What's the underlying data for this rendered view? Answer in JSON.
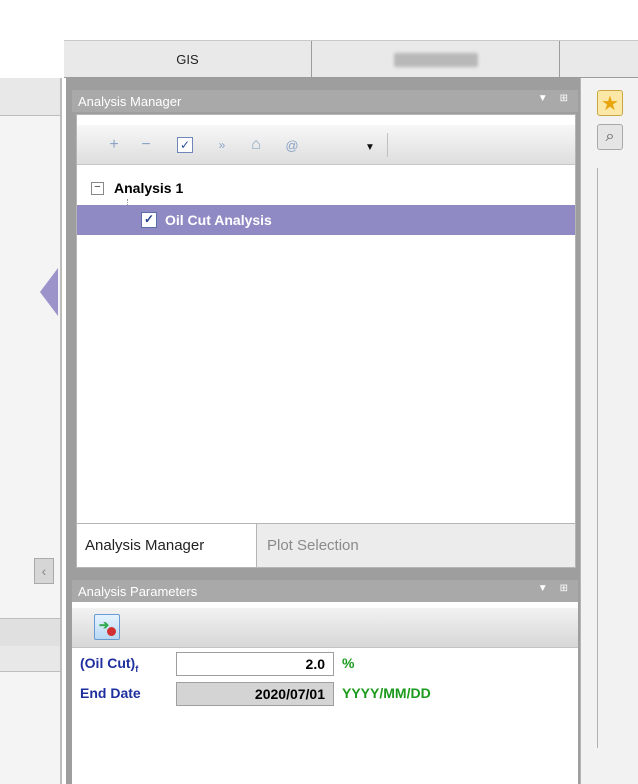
{
  "top_tabs": [
    {
      "label": "GIS"
    },
    {
      "label": ""
    }
  ],
  "analysis_manager": {
    "title": "Analysis Manager",
    "toolbar": {
      "items": [
        "plus-icon",
        "minus-icon",
        "checkbox-icon",
        "chevron-double-down-icon",
        "home-icon",
        "at-icon",
        "dropdown-arrow-icon"
      ]
    },
    "tree": {
      "root_label": "Analysis 1",
      "root_expander": "−",
      "child_label": "Oil Cut Analysis",
      "child_checked": "✓"
    }
  },
  "bottom_tabs": [
    {
      "label": "Analysis Manager"
    },
    {
      "label": "Plot Selection"
    }
  ],
  "analysis_parameters": {
    "title": "Analysis Parameters",
    "rows": [
      {
        "label_main": "(Oil Cut)",
        "label_sub": "f",
        "value": "2.0",
        "unit": "%"
      },
      {
        "label_main": "End Date",
        "label_sub": "",
        "value": "2020/07/01",
        "unit": "YYYY/MM/DD"
      }
    ]
  },
  "colors": {
    "selection": "#8f89c4",
    "titlebar": "#a9a9a9",
    "label_blue": "#1f2f9f",
    "unit_green": "#1c9a1c"
  }
}
